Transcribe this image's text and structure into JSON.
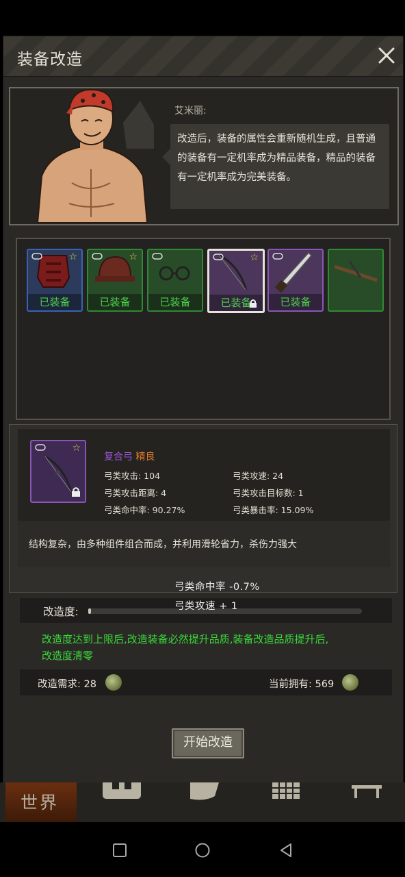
{
  "window": {
    "title": "装备改造"
  },
  "npc": {
    "speaker": "艾米丽:",
    "dialogue": "改造后，装备的属性会重新随机生成，且普通的装备有一定机率成为精品装备，精品的装备有一定机率成为完美装备。"
  },
  "equipment_slots": [
    {
      "label": "已装备",
      "rarity_color": "#3a62b4",
      "item": "armor",
      "starred": true,
      "locked": false,
      "selected": false
    },
    {
      "label": "已装备",
      "rarity_color": "#2f8a34",
      "item": "helmet",
      "starred": true,
      "locked": false,
      "selected": false
    },
    {
      "label": "已装备",
      "rarity_color": "#2f8a34",
      "item": "glasses",
      "starred": false,
      "locked": false,
      "selected": false
    },
    {
      "label": "已装备",
      "rarity_color": "#8a56b6",
      "item": "compound-bow",
      "starred": true,
      "locked": true,
      "selected": true
    },
    {
      "label": "已装备",
      "rarity_color": "#8a56b6",
      "item": "machete",
      "starred": false,
      "locked": false,
      "selected": false
    },
    {
      "label": "",
      "rarity_color": "#2f8a34",
      "item": "crossbow",
      "starred": false,
      "locked": false,
      "selected": false
    }
  ],
  "item": {
    "name": "复合弓",
    "quality": "精良",
    "name_color": "#9a55d6",
    "quality_color": "#e07a2a",
    "stats": {
      "attack": "弓类攻击: 104",
      "attack_speed": "弓类攻速: 24",
      "range": "弓类攻击距离: 4",
      "targets": "弓类攻击目标数: 1",
      "hit_rate": "弓类命中率: 90.27%",
      "crit_rate": "弓类暴击率: 15.09%"
    },
    "description": "结构复杂，由多种组件组合而成，并利用滑轮省力，杀伤力强大"
  },
  "bonuses": {
    "line1": "弓类命中率 -0.7%",
    "line2": "弓类攻速 + 1"
  },
  "refine": {
    "progress_label": "改造度:",
    "progress": 0.01,
    "hint": "改造度达到上限后,改造装备必然提升品质,装备改造品质提升后,改造度清零",
    "cost_label": "改造需求: 28",
    "owned_label": "当前拥有: 569",
    "start_button": "开始改造"
  },
  "tabs": {
    "world": "世界"
  },
  "colors": {
    "hint_green": "#3bd83b",
    "equipped_green": "#4ed04a"
  }
}
